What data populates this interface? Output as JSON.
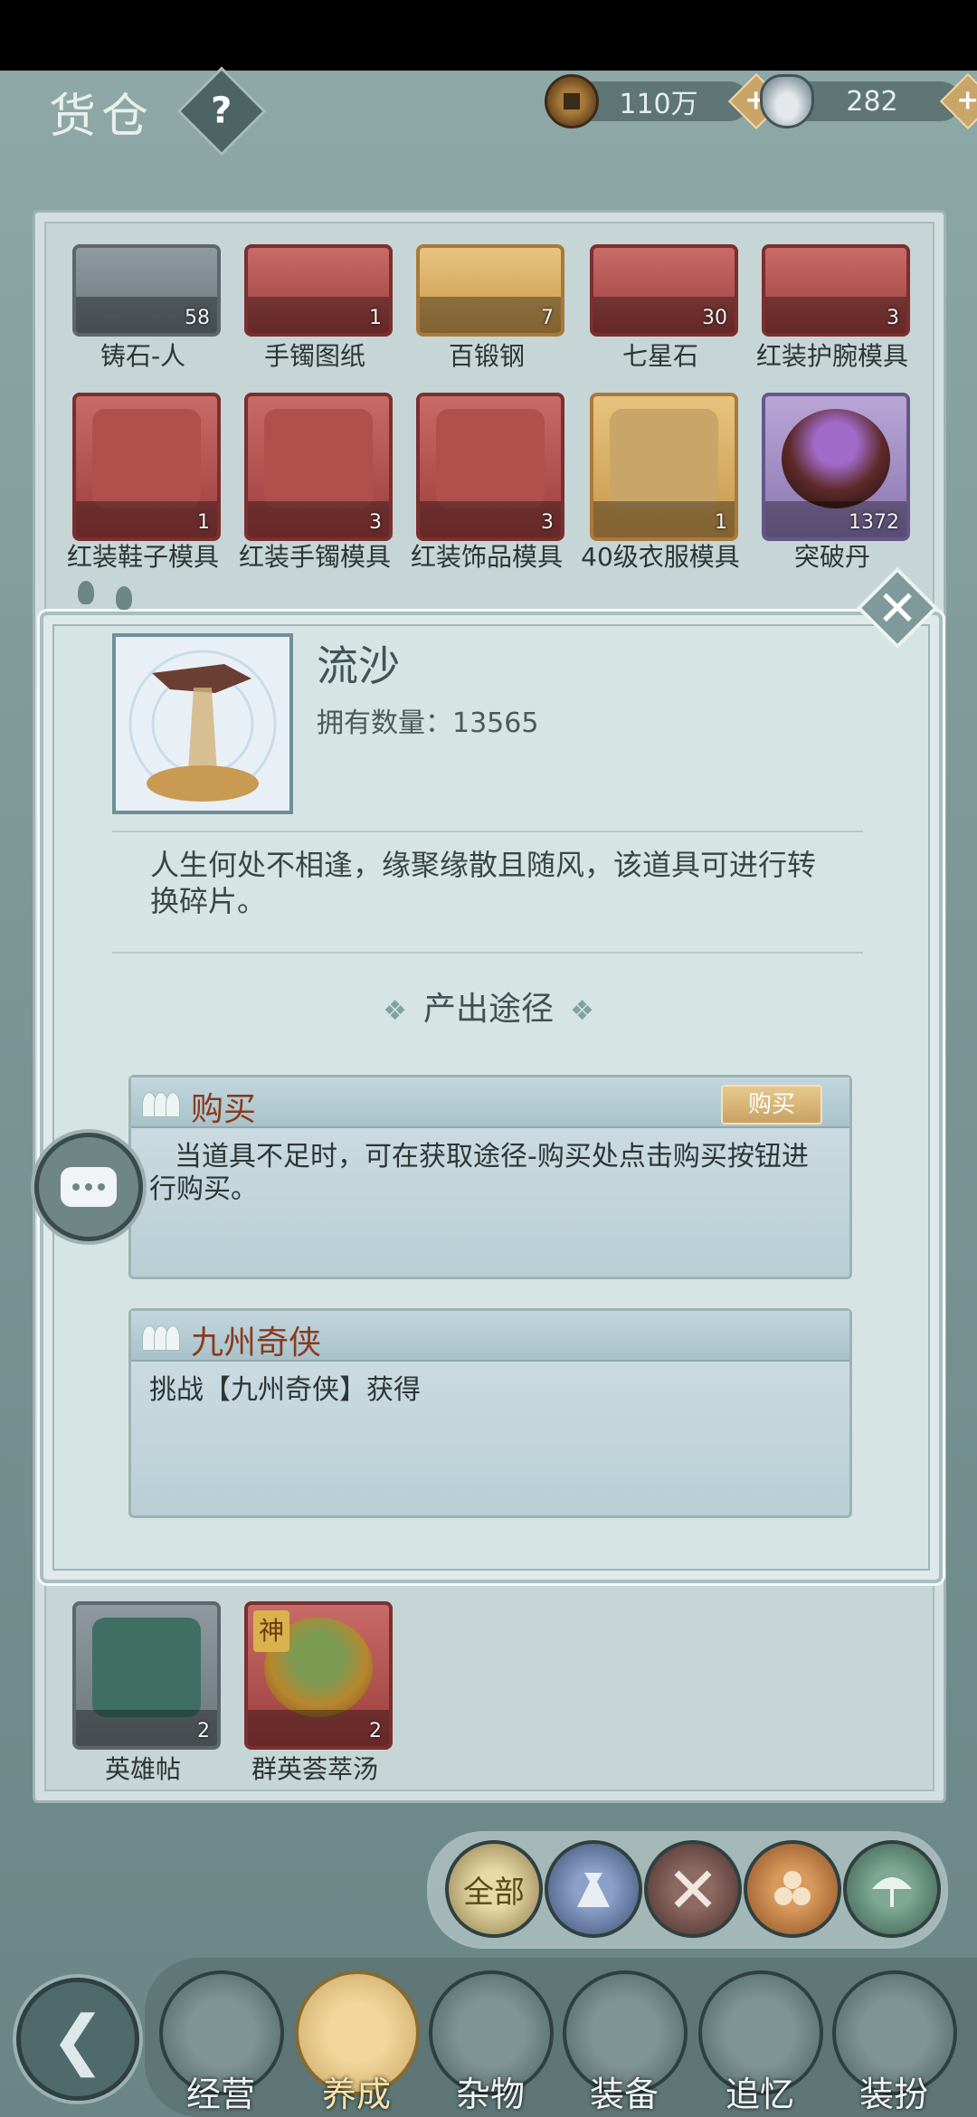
{
  "header": {
    "title": "货仓",
    "help_symbol": "?",
    "coins": "110万",
    "silver": "282",
    "plus_symbol": "+"
  },
  "inventory": {
    "row1": [
      {
        "name": "铸石-人",
        "count": "58",
        "frame": "gray"
      },
      {
        "name": "手镯图纸",
        "count": "1",
        "frame": "red"
      },
      {
        "name": "百锻钢",
        "count": "7",
        "frame": "orange"
      },
      {
        "name": "七星石",
        "count": "30",
        "frame": "red"
      },
      {
        "name": "红装护腕模具",
        "count": "3",
        "frame": "red"
      }
    ],
    "row2": [
      {
        "name": "红装鞋子模具",
        "count": "1",
        "frame": "red"
      },
      {
        "name": "红装手镯模具",
        "count": "3",
        "frame": "red"
      },
      {
        "name": "红装饰品模具",
        "count": "3",
        "frame": "red"
      },
      {
        "name": "40级衣服模具",
        "count": "1",
        "frame": "orange"
      },
      {
        "name": "突破丹",
        "count": "1372",
        "frame": "purple"
      }
    ],
    "row3": [
      {
        "name": "英雄帖",
        "count": "2",
        "frame": "gray"
      },
      {
        "name": "群英荟萃汤",
        "count": "2",
        "frame": "red",
        "tag": "神"
      }
    ]
  },
  "popup": {
    "item_name": "流沙",
    "count_line": "拥有数量：13565",
    "description": "人生何处不相逢，缘聚缘散且随风，该道具可进行转换碎片。",
    "section_title": "产出途径",
    "ornament": "❖",
    "close_symbol": "✕",
    "sources": [
      {
        "name": "购买",
        "button": "购买",
        "text": "当道具不足时，可在获取途径-购买处点击购买按钮进行购买。"
      },
      {
        "name": "九州奇侠",
        "text": "挑战【九州奇侠】获得"
      }
    ]
  },
  "filters": [
    {
      "label": "全部",
      "active": true
    },
    {
      "label": "",
      "icon": "bag-icon"
    },
    {
      "label": "",
      "icon": "crossed-tools-icon"
    },
    {
      "label": "",
      "icon": "logs-icon"
    },
    {
      "label": "",
      "icon": "umbrella-icon"
    }
  ],
  "nav": {
    "back_symbol": "❮",
    "items": [
      "经营",
      "养成",
      "杂物",
      "装备",
      "追忆",
      "装扮"
    ],
    "active_index": 1
  },
  "colors": {
    "accent_gold": "#c9a263",
    "source_title": "#8a3a1e",
    "panel_bg": "#d7e4e4"
  }
}
